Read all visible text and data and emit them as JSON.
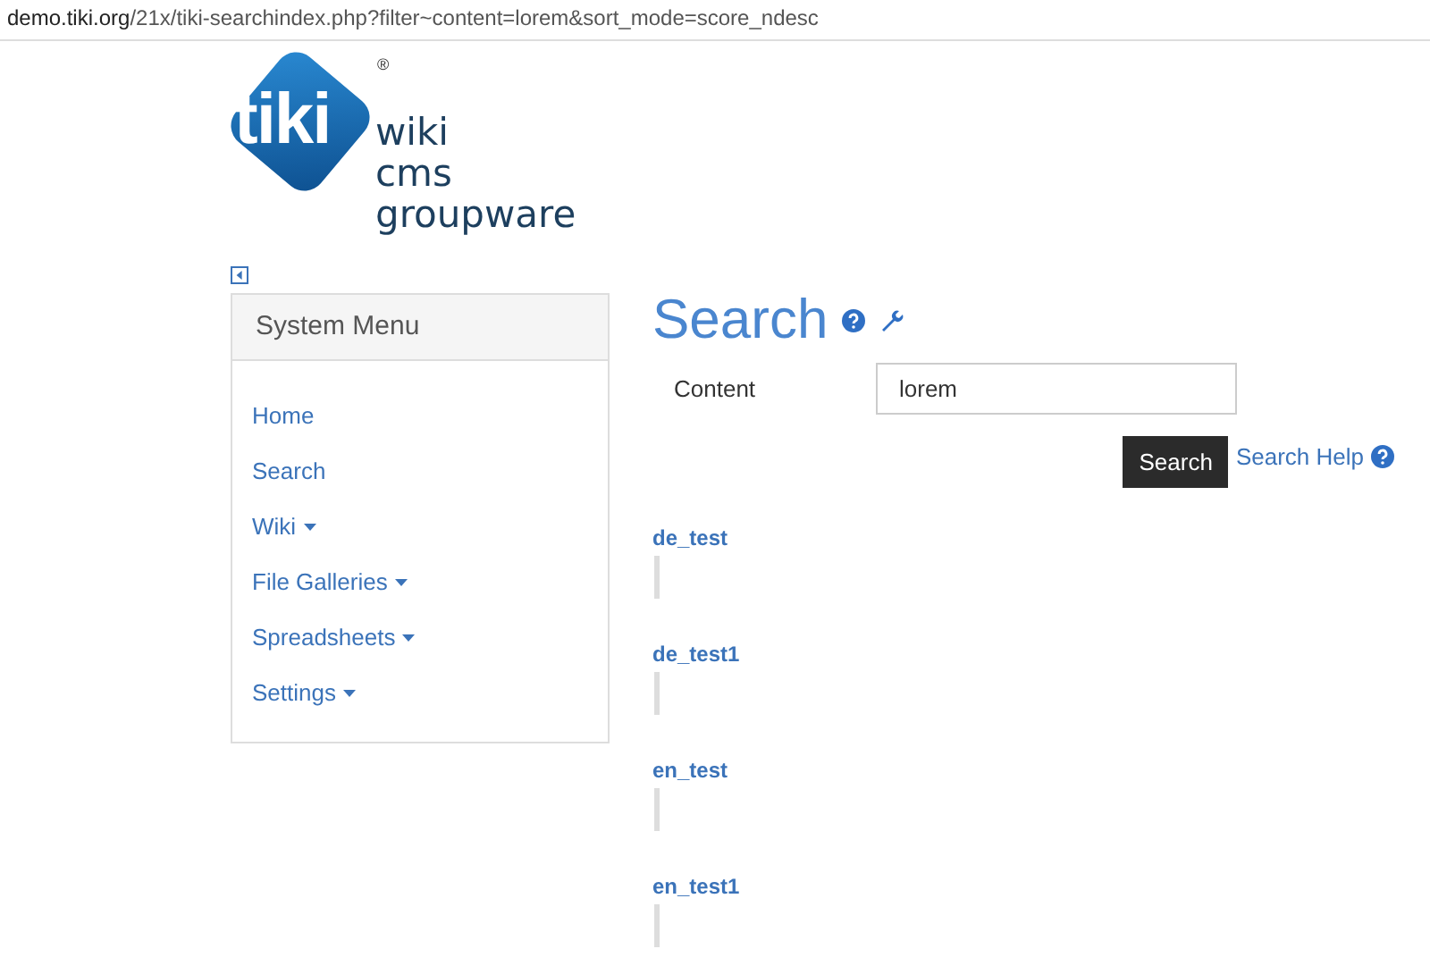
{
  "address_bar": {
    "host": "demo.tiki.org",
    "path": "/21x/tiki-searchindex.php?filter~content=lorem&sort_mode=score_ndesc"
  },
  "logo": {
    "badge": "tiki",
    "registered": "®",
    "lines": [
      "wiki",
      "cms",
      "groupware"
    ]
  },
  "sidebar": {
    "title": "System Menu",
    "items": [
      {
        "label": "Home",
        "dropdown": false
      },
      {
        "label": "Search",
        "dropdown": false
      },
      {
        "label": "Wiki",
        "dropdown": true
      },
      {
        "label": "File Galleries",
        "dropdown": true
      },
      {
        "label": "Spreadsheets",
        "dropdown": true
      },
      {
        "label": "Settings",
        "dropdown": true
      }
    ]
  },
  "search": {
    "title": "Search",
    "field_label": "Content",
    "value": "lorem",
    "button": "Search",
    "help_link": "Search Help"
  },
  "results": [
    {
      "title": "de_test"
    },
    {
      "title": "de_test1"
    },
    {
      "title": "en_test"
    },
    {
      "title": "en_test1"
    }
  ]
}
